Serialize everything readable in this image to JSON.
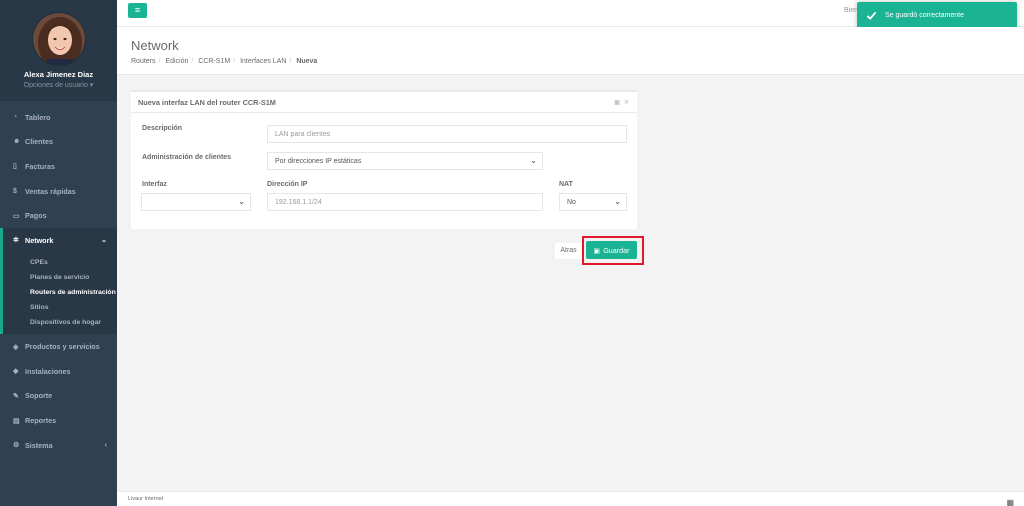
{
  "topbar": {
    "menu_icon": "hamburger-icon",
    "welcome_text": "Bien"
  },
  "toast": {
    "message": "Se guardó correctamente",
    "icon": "check-icon",
    "color": "#1ab394"
  },
  "profile": {
    "name": "Alexa Jimenez Diaz",
    "options": "Opciones de usuario ▾"
  },
  "sidebar": {
    "items": [
      {
        "label": "Tablero",
        "icon": "dashboard-icon"
      },
      {
        "label": "Clientes",
        "icon": "users-icon"
      },
      {
        "label": "Facturas",
        "icon": "document-icon"
      },
      {
        "label": "Ventas rápidas",
        "icon": "dollar-icon"
      },
      {
        "label": "Pagos",
        "icon": "money-icon"
      },
      {
        "label": "Network",
        "icon": "network-icon"
      },
      {
        "label": "Productos y servicios",
        "icon": "tag-icon"
      },
      {
        "label": "Instalaciones",
        "icon": "wrench-icon"
      },
      {
        "label": "Soporte",
        "icon": "support-icon"
      },
      {
        "label": "Reportes",
        "icon": "book-icon"
      },
      {
        "label": "Sistema",
        "icon": "cogs-icon"
      }
    ],
    "network_sub": [
      {
        "label": "CPEs"
      },
      {
        "label": "Planes de servicio"
      },
      {
        "label": "Routers de administración"
      },
      {
        "label": "Sitios"
      },
      {
        "label": "Dispositivos de hogar"
      }
    ]
  },
  "heading": {
    "title": "Network",
    "breadcrumb": [
      "Routers",
      "Edición",
      "CCR-S1M",
      "Interfaces LAN",
      "Nueva"
    ]
  },
  "form": {
    "title": "Nueva interfaz LAN del router CCR-S1M",
    "descripcion_label": "Descripción",
    "descripcion_placeholder": "LAN para clientes",
    "admin_label": "Administración de clientes",
    "admin_value": "Por direcciones IP estáticas",
    "interfaz_label": "Interfaz",
    "interfaz_value": "",
    "ip_label": "Dirección IP",
    "ip_placeholder": "192.168.1.1/24",
    "nat_label": "NAT",
    "nat_value": "No"
  },
  "actions": {
    "back": "Atras",
    "save": "Guardar",
    "highlight_color": "#e0192c"
  },
  "footer": {
    "brand": "Livaur Internet"
  }
}
